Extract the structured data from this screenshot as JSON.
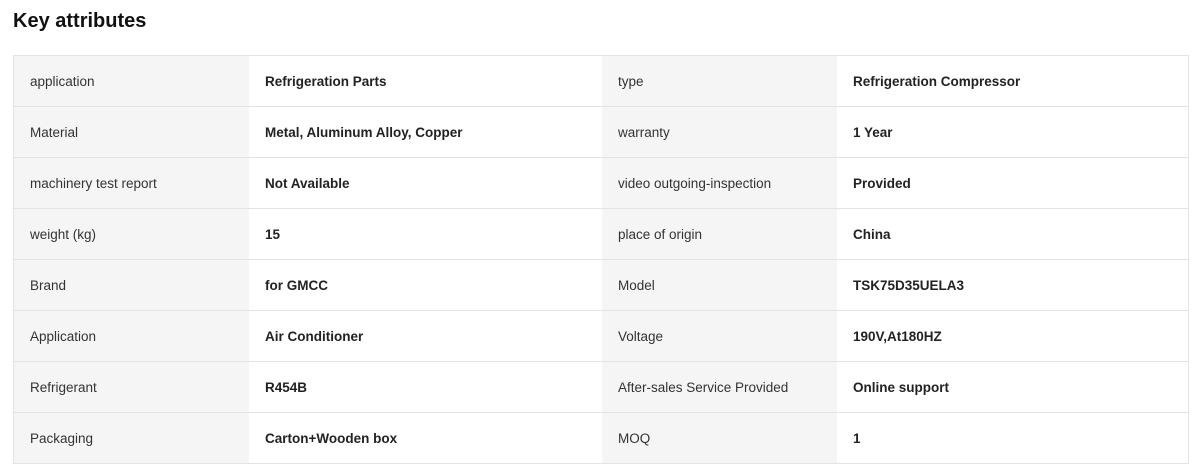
{
  "section": {
    "title": "Key attributes"
  },
  "attributes": [
    {
      "key1": "application",
      "val1": "Refrigeration Parts",
      "key2": "type",
      "val2": "Refrigeration Compressor"
    },
    {
      "key1": "Material",
      "val1": "Metal, Aluminum Alloy, Copper",
      "key2": "warranty",
      "val2": "1 Year"
    },
    {
      "key1": "machinery test report",
      "val1": "Not Available",
      "key2": "video outgoing-inspection",
      "val2": "Provided"
    },
    {
      "key1": "weight (kg)",
      "val1": "15",
      "key2": "place of origin",
      "val2": "China"
    },
    {
      "key1": "Brand",
      "val1": "for GMCC",
      "key2": "Model",
      "val2": "TSK75D35UELA3"
    },
    {
      "key1": "Application",
      "val1": "Air Conditioner",
      "key2": "Voltage",
      "val2": "190V,At180HZ"
    },
    {
      "key1": "Refrigerant",
      "val1": "R454B",
      "key2": "After-sales Service Provided",
      "val2": "Online support"
    },
    {
      "key1": "Packaging",
      "val1": "Carton+Wooden box",
      "key2": "MOQ",
      "val2": "1"
    }
  ],
  "colors": {
    "key_background": "#f5f5f5",
    "border": "#e3e3e3",
    "text": "#222222"
  }
}
